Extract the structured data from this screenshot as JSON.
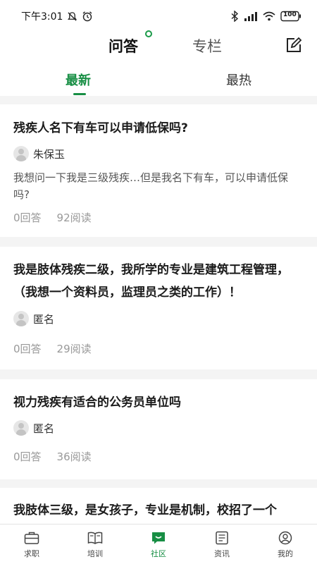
{
  "status_bar": {
    "time": "下午3:01",
    "battery": "100",
    "icons": [
      "mute-icon",
      "alarm-icon",
      "bluetooth-icon",
      "signal-icon",
      "wifi-icon",
      "battery-icon"
    ]
  },
  "top_tabs": [
    {
      "label": "问答",
      "active": true
    },
    {
      "label": "专栏",
      "active": false
    }
  ],
  "edit_icon": "edit-icon",
  "sub_tabs": [
    {
      "label": "最新",
      "active": true
    },
    {
      "label": "最热",
      "active": false
    }
  ],
  "posts": [
    {
      "title": "残疾人名下有车可以申请低保吗?",
      "author": "朱保玉",
      "excerpt": "我想问一下我是三级残疾…但是我名下有车，可以申请低保吗?",
      "answers": "0回答",
      "reads": "92阅读"
    },
    {
      "title": "我是肢体残疾二级，我所学的专业是建筑工程管理，（我想一个资料员，监理员之类的工作）！",
      "author": "匿名",
      "excerpt": "",
      "answers": "0回答",
      "reads": "29阅读"
    },
    {
      "title": "视力残疾有适合的公务员单位吗",
      "author": "匿名",
      "excerpt": "",
      "answers": "0回答",
      "reads": "36阅读"
    },
    {
      "title": "我肢体三级，是女孩子，专业是机制，校招了一个",
      "author": "",
      "excerpt": "",
      "answers": "",
      "reads": ""
    }
  ],
  "bottom_nav": [
    {
      "label": "求职",
      "icon": "briefcase-icon",
      "active": false
    },
    {
      "label": "培训",
      "icon": "book-icon",
      "active": false
    },
    {
      "label": "社区",
      "icon": "chat-icon",
      "active": true
    },
    {
      "label": "资讯",
      "icon": "news-icon",
      "active": false
    },
    {
      "label": "我的",
      "icon": "profile-icon",
      "active": false
    }
  ],
  "colors": {
    "accent": "#178e44",
    "background_gap": "#f4f4f4",
    "muted_text": "#999999"
  }
}
